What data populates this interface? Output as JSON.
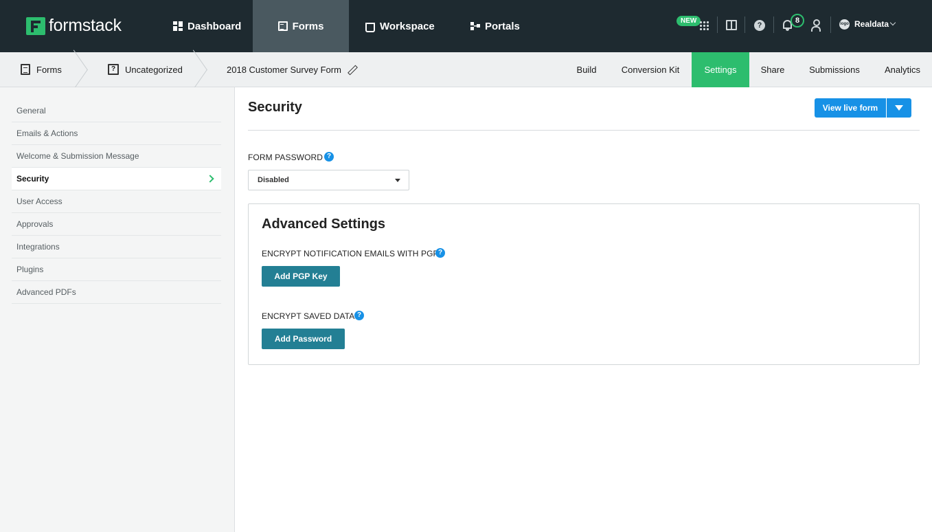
{
  "brand": {
    "name": "formstack",
    "accent": "#2dbd6e",
    "nav_bg": "#1e2a30",
    "button_blue": "#1791e6",
    "button_teal": "#237f94"
  },
  "topnav": {
    "items": [
      {
        "label": "Dashboard",
        "icon": "dashboard-icon"
      },
      {
        "label": "Forms",
        "icon": "forms-icon",
        "active": true
      },
      {
        "label": "Workspace",
        "icon": "workspace-icon"
      },
      {
        "label": "Portals",
        "icon": "portals-icon"
      }
    ],
    "new_badge": "NEW",
    "help_glyph": "?",
    "notifications_count": "8",
    "account_initials": "logo",
    "account_name": "Realdata"
  },
  "breadcrumb": {
    "forms": "Forms",
    "category_glyph": "?",
    "category": "Uncategorized",
    "form_title": "2018 Customer Survey Form"
  },
  "tabs": [
    {
      "label": "Build"
    },
    {
      "label": "Conversion Kit"
    },
    {
      "label": "Settings",
      "active": true
    },
    {
      "label": "Share"
    },
    {
      "label": "Submissions"
    },
    {
      "label": "Analytics"
    }
  ],
  "sidebar": {
    "items": [
      {
        "label": "General"
      },
      {
        "label": "Emails & Actions"
      },
      {
        "label": "Welcome & Submission Message"
      },
      {
        "label": "Security",
        "active": true
      },
      {
        "label": "User Access"
      },
      {
        "label": "Approvals"
      },
      {
        "label": "Integrations"
      },
      {
        "label": "Plugins"
      },
      {
        "label": "Advanced PDFs"
      }
    ]
  },
  "main": {
    "title": "Security",
    "view_live_form": "View live form",
    "form_password_label": "FORM PASSWORD",
    "help_glyph": "?",
    "form_password_value": "Disabled",
    "advanced": {
      "title": "Advanced Settings",
      "pgp_label": "ENCRYPT NOTIFICATION EMAILS WITH PGP",
      "pgp_button": "Add PGP Key",
      "saved_label": "ENCRYPT SAVED DATA",
      "saved_button": "Add Password"
    }
  }
}
